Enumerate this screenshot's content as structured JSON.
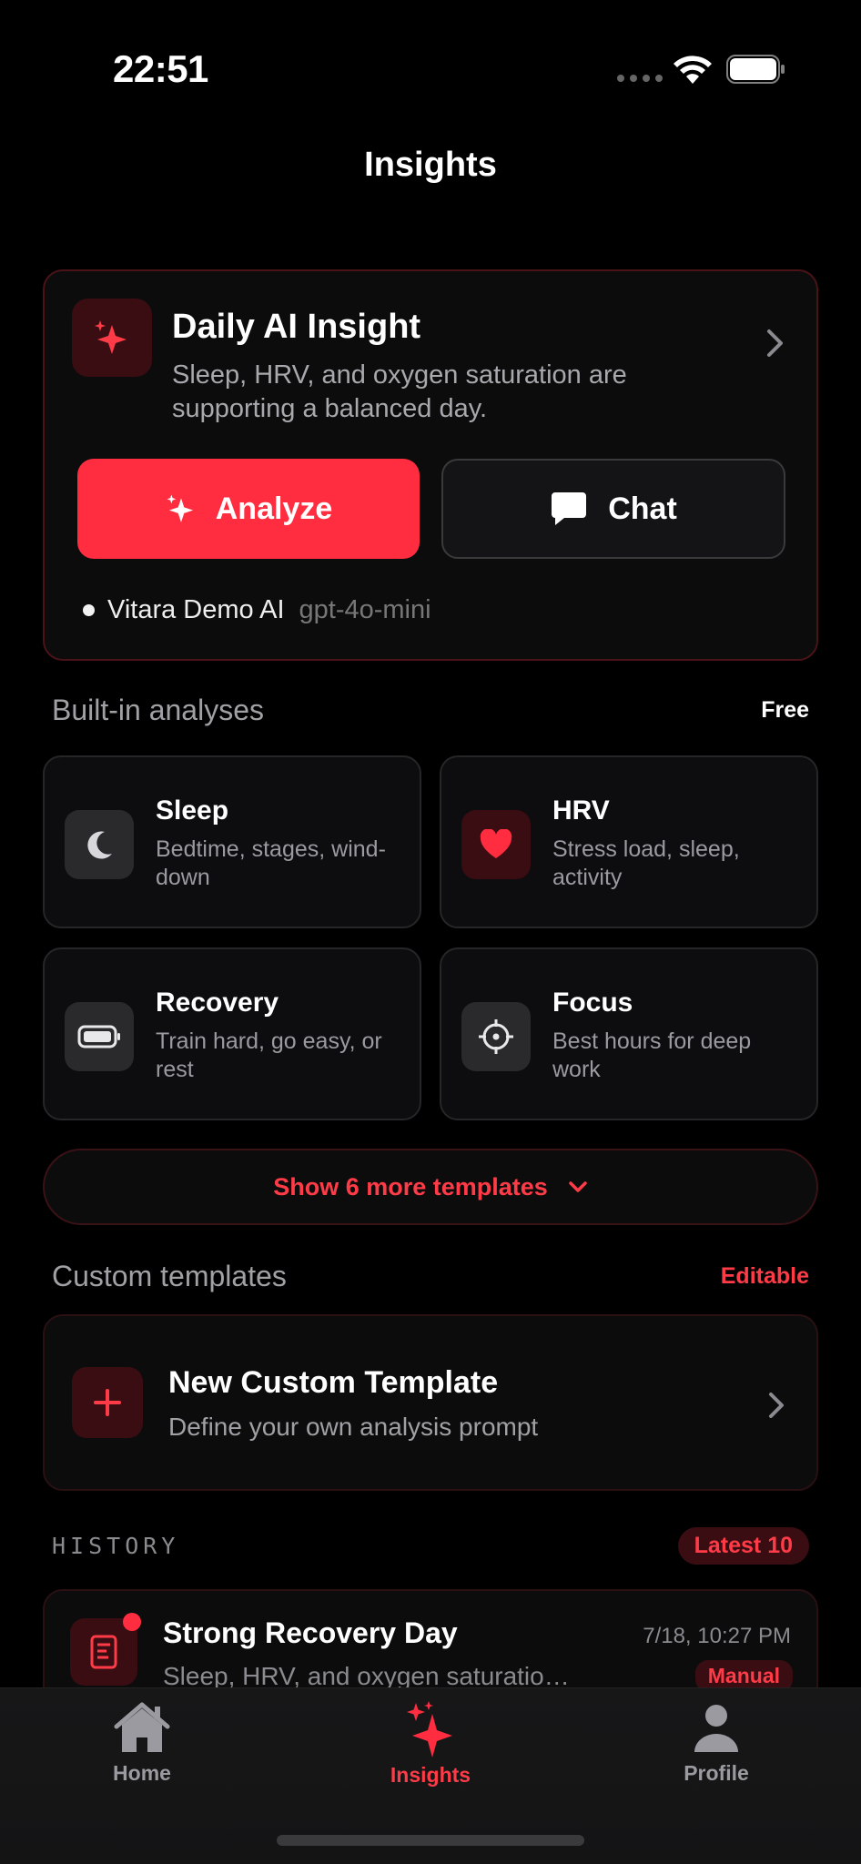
{
  "status_bar": {
    "time": "22:51"
  },
  "nav": {
    "title": "Insights"
  },
  "daily_insight": {
    "title": "Daily AI Insight",
    "subtitle": "Sleep, HRV, and oxygen saturation are supporting a balanced day.",
    "analyze_label": "Analyze",
    "chat_label": "Chat",
    "model_name": "Vitara Demo AI",
    "model_id": "gpt-4o-mini"
  },
  "builtin": {
    "title": "Built-in analyses",
    "badge": "Free",
    "tiles": [
      {
        "title": "Sleep",
        "subtitle": "Bedtime, stages, wind-down",
        "icon": "moon-icon"
      },
      {
        "title": "HRV",
        "subtitle": "Stress load, sleep, activity",
        "icon": "heart-icon"
      },
      {
        "title": "Recovery",
        "subtitle": "Train hard, go easy, or rest",
        "icon": "battery-icon"
      },
      {
        "title": "Focus",
        "subtitle": "Best hours for deep work",
        "icon": "crosshair-icon"
      }
    ],
    "more_label": "Show 6 more templates"
  },
  "custom": {
    "title": "Custom templates",
    "badge": "Editable",
    "new_title": "New Custom Template",
    "new_subtitle": "Define your own analysis prompt"
  },
  "history": {
    "title": "HISTORY",
    "badge": "Latest 10",
    "items": [
      {
        "title": "Strong Recovery Day",
        "subtitle": "Sleep, HRV, and oxygen saturatio…",
        "date": "7/18, 10:27 PM",
        "tag": "Manual"
      }
    ]
  },
  "tabbar": {
    "tabs": [
      {
        "label": "Home",
        "icon": "house-icon"
      },
      {
        "label": "Insights",
        "icon": "sparkles-icon"
      },
      {
        "label": "Profile",
        "icon": "person-icon"
      }
    ],
    "active": "Insights"
  },
  "colors": {
    "accent": "#ff2d3f",
    "background": "#000000",
    "card": "#0c0c0d"
  }
}
